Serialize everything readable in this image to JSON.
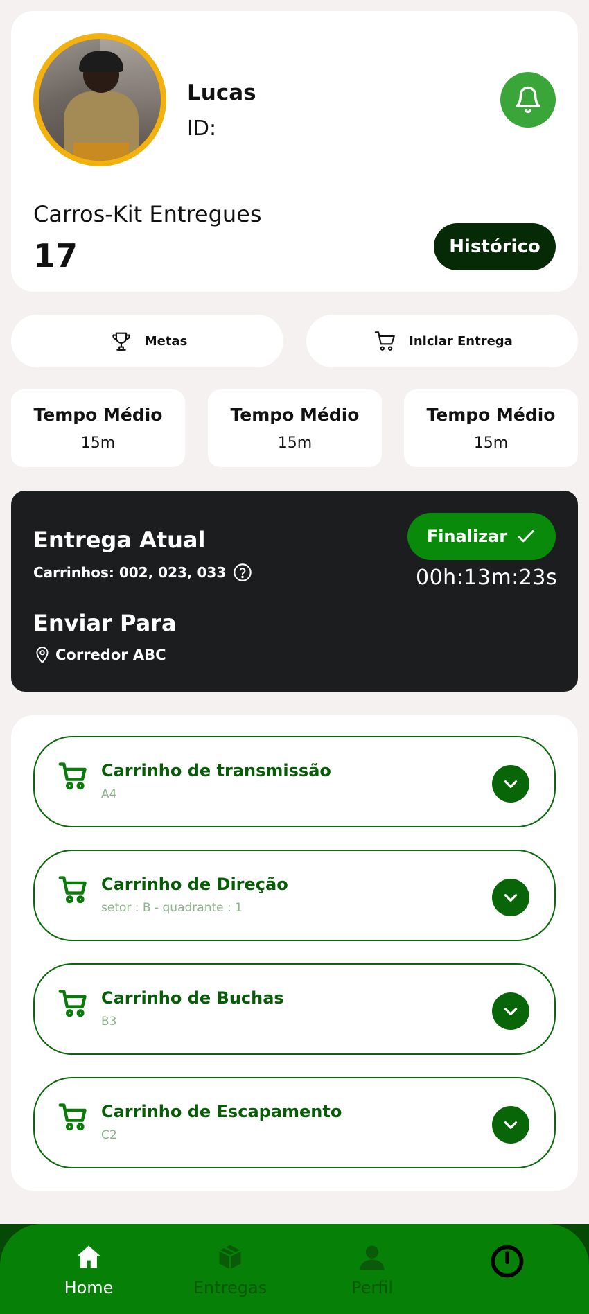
{
  "profile": {
    "name": "Lucas",
    "id_label": "ID:",
    "kits_label": "Carros-Kit Entregues",
    "kits_count": "17",
    "history_button": "Histórico"
  },
  "actions": {
    "metas": "Metas",
    "iniciar_entrega": "Iniciar Entrega"
  },
  "stats": [
    {
      "title": "Tempo Médio",
      "value": "15m"
    },
    {
      "title": "Tempo Médio",
      "value": "15m"
    },
    {
      "title": "Tempo Médio",
      "value": "15m"
    }
  ],
  "delivery": {
    "title": "Entrega Atual",
    "carts": "Carrinhos: 002, 023, 033",
    "finish_button": "Finalizar",
    "timer": "00h:13m:23s",
    "send_to_title": "Enviar Para",
    "location": "Corredor ABC"
  },
  "carts": [
    {
      "name": "Carrinho de transmissão",
      "sub": "A4"
    },
    {
      "name": "Carrinho de Direção",
      "sub": "setor : B - quadrante : 1"
    },
    {
      "name": "Carrinho de Buchas",
      "sub": "B3"
    },
    {
      "name": "Carrinho de Escapamento",
      "sub": "C2"
    }
  ],
  "nav": {
    "home": "Home",
    "entregas": "Entregas",
    "perfil": "Perfil"
  },
  "colors": {
    "accent_green": "#078007",
    "dark_green": "#062a06",
    "avatar_ring": "#f2b10c",
    "delivery_bg": "#1c1d1e"
  },
  "icons": [
    "bell-icon",
    "trophy-icon",
    "cart-icon",
    "help-icon",
    "map-pin-icon",
    "check-icon",
    "chevron-down-icon",
    "home-icon",
    "box-icon",
    "user-icon",
    "power-icon"
  ]
}
